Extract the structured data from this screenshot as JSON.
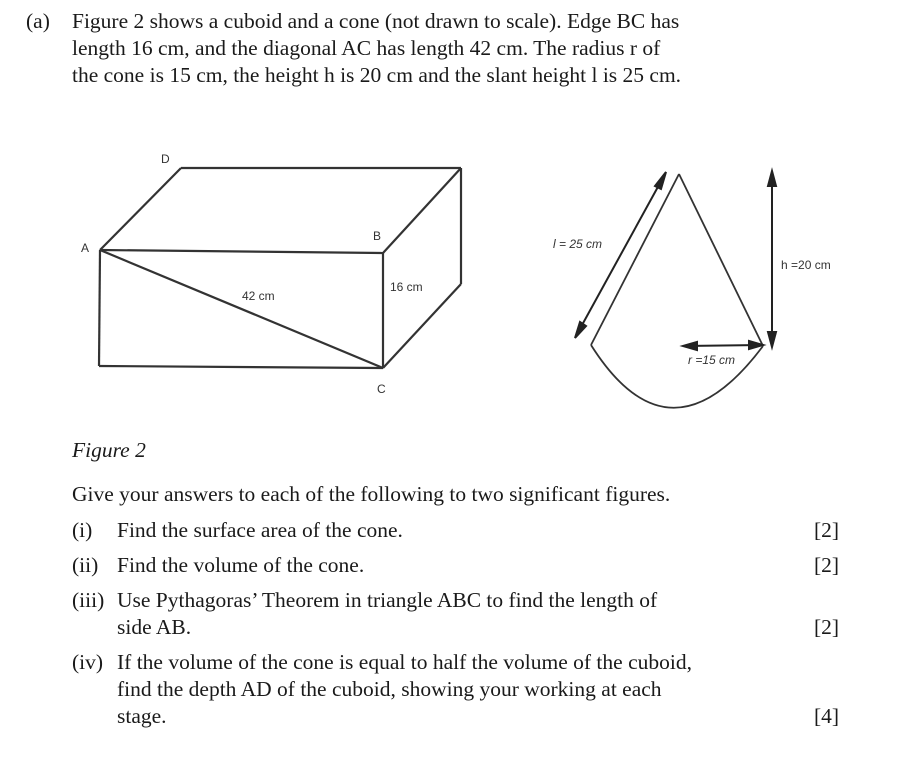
{
  "intro": {
    "part_label": "(a)",
    "line1": "Figure 2 shows a cuboid and a cone (not drawn to scale). Edge BC has",
    "line2": "length 16 cm, and the diagonal AC has length 42 cm. The radius r of",
    "line3": "the cone is 15 cm, the height h is 20 cm and the slant height l is 25 cm."
  },
  "cuboid": {
    "vertex_labels": {
      "A": "A",
      "B": "B",
      "C": "C",
      "D": "D"
    },
    "diagonal_label": "42 cm",
    "edge_bc_label": "16 cm"
  },
  "cone": {
    "slant_label": "l = 25 cm",
    "height_label": "h =20 cm",
    "radius_label": "r =15 cm"
  },
  "caption": "Figure 2",
  "instruction": "Give your answers to each of the following to two significant figures.",
  "questions": [
    {
      "num": "(i)",
      "lines": [
        "Find the surface area of the cone."
      ],
      "marks": "[2]"
    },
    {
      "num": "(ii)",
      "lines": [
        "Find the volume of the cone."
      ],
      "marks": "[2]"
    },
    {
      "num": "(iii)",
      "lines": [
        "Use Pythagoras’ Theorem in triangle ABC to find the length of",
        "side AB."
      ],
      "marks": "[2]"
    },
    {
      "num": "(iv)",
      "lines": [
        "If the volume of the cone is equal to half the volume of the cuboid,",
        "find the depth AD of the cuboid, showing your working at each",
        "stage."
      ],
      "marks": "[4]"
    }
  ]
}
